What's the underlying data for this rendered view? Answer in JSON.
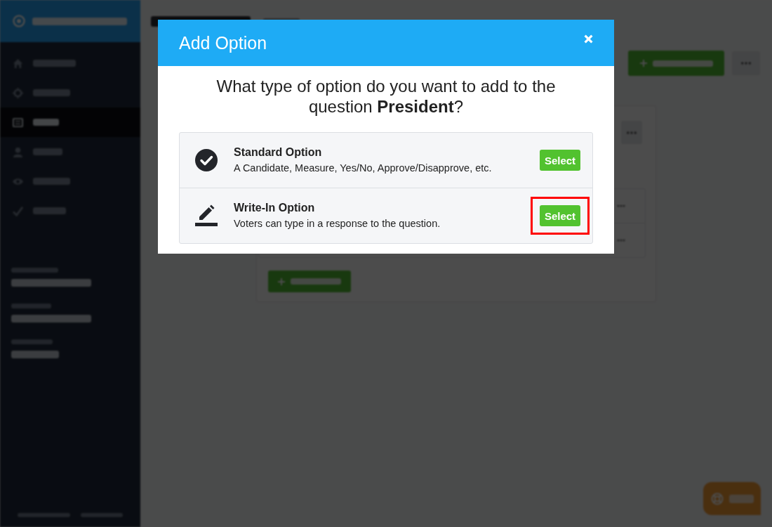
{
  "sidebar": {
    "nav": [
      {
        "selected": false
      },
      {
        "selected": false
      },
      {
        "selected": true
      },
      {
        "selected": false
      },
      {
        "selected": false
      },
      {
        "selected": false
      }
    ]
  },
  "modal": {
    "title": "Add Option",
    "question": "What type of option do you want to add to the question **President**?",
    "options": [
      {
        "kind": "standard",
        "title": "Standard Option",
        "description": "A Candidate, Measure, Yes/No, Approve/Disapprove, etc.",
        "button": "Select",
        "highlighted": false
      },
      {
        "kind": "write_in",
        "title": "Write-In Option",
        "description": "Voters can type in a response to the question.",
        "button": "Select",
        "highlighted": true
      }
    ]
  }
}
